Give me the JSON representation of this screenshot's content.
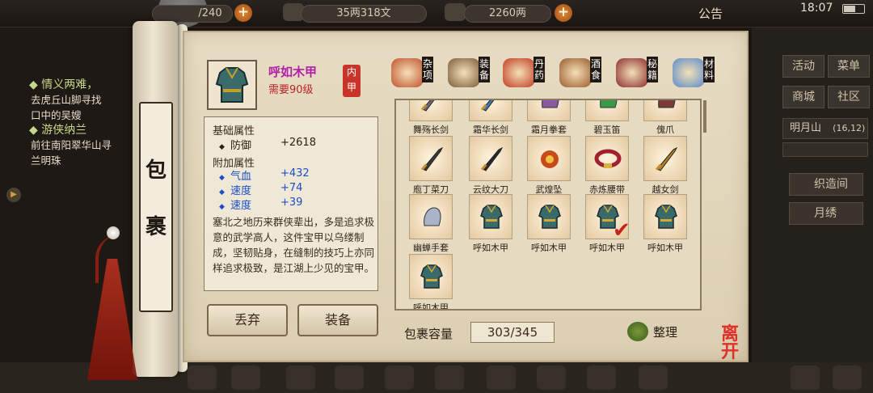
{
  "topbar": {
    "stamina": "/240",
    "coins": "35两318文",
    "gold": "2260两",
    "announcement": "公告",
    "time": "18:07"
  },
  "quests": [
    {
      "title": "情义两难，",
      "desc": [
        "去虎丘山脚寻找",
        "口中的吴嫂"
      ]
    },
    {
      "title": "游侠纳兰",
      "desc": [
        "前往南阳翠华山寻",
        "兰明珠"
      ]
    }
  ],
  "right_panel": {
    "activity": "活动",
    "menu": "菜单",
    "shop": "商城",
    "community": "社区",
    "location": "明月山",
    "coords": "(16,12)",
    "tasks": [
      "织造间",
      "月绣"
    ]
  },
  "scroll_title": [
    "包",
    "裹"
  ],
  "item": {
    "name": "呼如木甲",
    "requirement": "需要90级",
    "slot": "内甲",
    "base_header": "基础属性",
    "base_stats": [
      {
        "name": "防御",
        "value": "+2618"
      }
    ],
    "extra_header": "附加属性",
    "extra_stats": [
      {
        "name": "气血",
        "value": "+432"
      },
      {
        "name": "速度",
        "value": "+74"
      },
      {
        "name": "速度",
        "value": "+39"
      }
    ],
    "description": "塞北之地历来群侠辈出，多是追求极意的武学高人，这件宝甲以乌缕制成，坚韧贴身，在缝制的技巧上亦同样追求极致，是江湖上少见的宝甲。"
  },
  "buttons": {
    "discard": "丢弃",
    "equip": "装备",
    "sort": "整理",
    "leave": "离开"
  },
  "categories": [
    {
      "label": "杂项",
      "color": "#c0502a"
    },
    {
      "label": "装备",
      "color": "#7a5a3a"
    },
    {
      "label": "丹药",
      "color": "#c03a20"
    },
    {
      "label": "酒食",
      "color": "#9a5a2a"
    },
    {
      "label": "秘籍",
      "color": "#8a2a2a"
    },
    {
      "label": "材料",
      "color": "#5a8ac8"
    }
  ],
  "inventory": {
    "rows": [
      [
        {
          "name": "舞殇长剑",
          "icon": "sword-icon",
          "color": "#6a6a7a"
        },
        {
          "name": "霜华长剑",
          "icon": "sword-icon",
          "color": "#3a7ab0"
        },
        {
          "name": "霜月拳套",
          "icon": "glove-icon",
          "color": "#8a5aa0"
        },
        {
          "name": "碧玉笛",
          "icon": "flute-icon",
          "color": "#3a9a4a"
        },
        {
          "name": "傀爪",
          "icon": "claw-icon",
          "color": "#7a3a3a"
        }
      ],
      [
        {
          "name": "庖丁菜刀",
          "icon": "cleaver-icon",
          "color": "#3a3a3a"
        },
        {
          "name": "云纹大刀",
          "icon": "blade-icon",
          "color": "#2a2a2a"
        },
        {
          "name": "武煌坠",
          "icon": "pendant-icon",
          "color": "#c84a1a"
        },
        {
          "name": "赤炼腰带",
          "icon": "belt-icon",
          "color": "#a02030"
        },
        {
          "name": "越女剑",
          "icon": "sword-icon",
          "color": "#b0801a"
        }
      ],
      [
        {
          "name": "幽蝉手套",
          "icon": "glove-icon",
          "color": "#aab4c8"
        },
        {
          "name": "呼如木甲",
          "icon": "armor-icon",
          "color": "#3a6a6a"
        },
        {
          "name": "呼如木甲",
          "icon": "armor-icon",
          "color": "#3a6a6a"
        },
        {
          "name": "呼如木甲",
          "icon": "armor-icon",
          "color": "#3a6a6a",
          "selected": true
        },
        {
          "name": "呼如木甲",
          "icon": "armor-icon",
          "color": "#3a6a6a"
        }
      ],
      [
        {
          "name": "呼如木甲",
          "icon": "armor-icon",
          "color": "#3a6a6a"
        }
      ]
    ]
  },
  "capacity": {
    "label": "包裹容量",
    "value": "303/345"
  }
}
